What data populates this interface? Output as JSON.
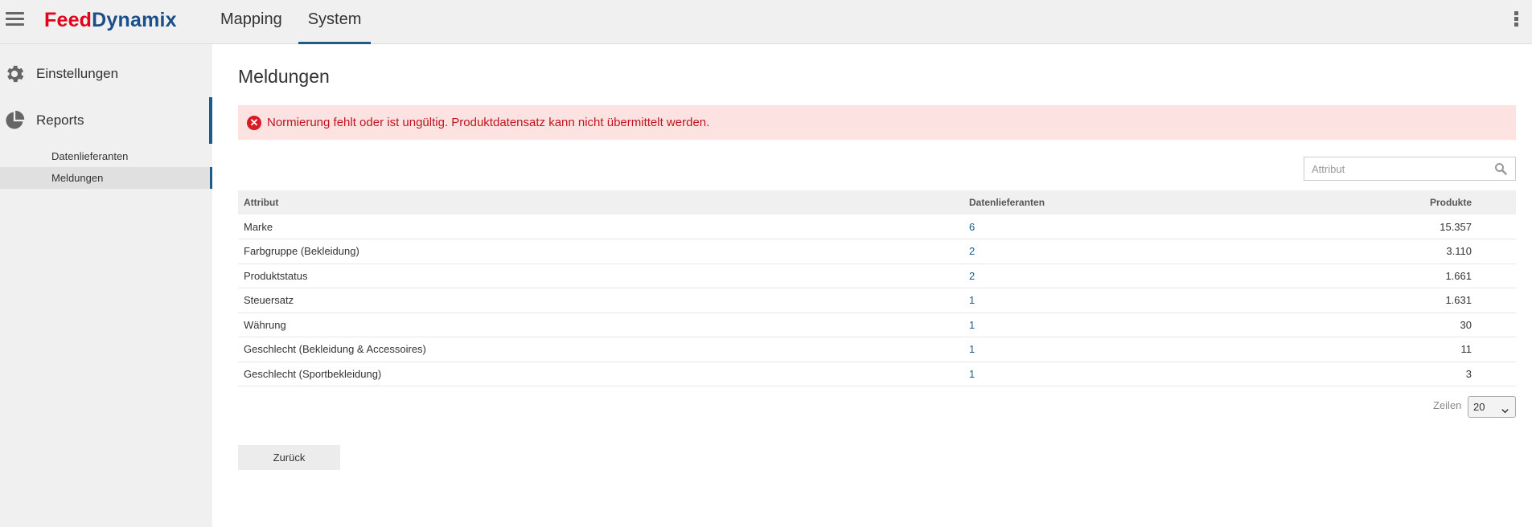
{
  "header": {
    "logo_part1": "Feed",
    "logo_part2": "Dynamix",
    "tabs": [
      {
        "label": "Mapping"
      },
      {
        "label": "System"
      }
    ],
    "active_tab": "System"
  },
  "sidebar": {
    "items": [
      {
        "label": "Einstellungen",
        "icon": "gear-icon"
      },
      {
        "label": "Reports",
        "icon": "pie-chart-icon"
      }
    ],
    "subitems": [
      {
        "label": "Datenlieferanten"
      },
      {
        "label": "Meldungen"
      }
    ]
  },
  "main": {
    "title": "Meldungen",
    "alert": {
      "message": "Normierung fehlt oder ist ungültig. Produktdatensatz kann nicht übermittelt werden.",
      "color": "#c0141e"
    },
    "search": {
      "placeholder": "Attribut",
      "value": ""
    },
    "table": {
      "headers": [
        "Attribut",
        "Datenlieferanten",
        "Produkte"
      ],
      "rows": [
        {
          "attribut": "Marke",
          "datenlieferanten": "6",
          "produkte": "15.357"
        },
        {
          "attribut": "Farbgruppe (Bekleidung)",
          "datenlieferanten": "2",
          "produkte": "3.110"
        },
        {
          "attribut": "Produktstatus",
          "datenlieferanten": "2",
          "produkte": "1.661"
        },
        {
          "attribut": "Steuersatz",
          "datenlieferanten": "1",
          "produkte": "1.631"
        },
        {
          "attribut": "Währung",
          "datenlieferanten": "1",
          "produkte": "30"
        },
        {
          "attribut": "Geschlecht (Bekleidung & Accessoires)",
          "datenlieferanten": "1",
          "produkte": "11"
        },
        {
          "attribut": "Geschlecht (Sportbekleidung)",
          "datenlieferanten": "1",
          "produkte": "3"
        }
      ]
    },
    "pagination": {
      "rows_label": "Zeilen",
      "rows_value": "20"
    },
    "back_button": "Zurück"
  },
  "colors": {
    "accent": "#1b5c8a",
    "brand_red": "#e2001a",
    "brand_blue": "#1b4f8a",
    "alert_bg": "#fde2e2"
  }
}
